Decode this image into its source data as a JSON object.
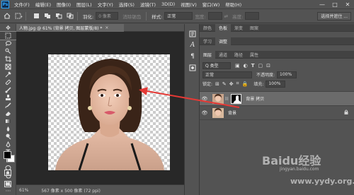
{
  "menubar": {
    "logo": "Ps",
    "items": [
      "文件(F)",
      "编辑(E)",
      "图像(I)",
      "图层(L)",
      "文字(Y)",
      "选择(S)",
      "滤镜(T)",
      "3D(D)",
      "视图(V)",
      "窗口(W)",
      "帮助(H)"
    ],
    "minimize": "—",
    "maximize": "□",
    "close": "✕"
  },
  "optbar": {
    "feather_label": "羽化:",
    "feather_value": "0 像素",
    "antialias_label": "消除锯齿",
    "style_label": "样式:",
    "style_value": "正常",
    "width_label": "宽度:",
    "height_label": "高度:",
    "select_mask_button": "选择并遮住 ..."
  },
  "document": {
    "tab_title": "人物.jpg @ 61% (背景 拷贝, 图层蒙版/8) *",
    "close": "×",
    "zoom": "61%",
    "size_info": "567 像素 x 500 像素 (72 ppi)"
  },
  "panels": {
    "top_tabs": [
      "颜色",
      "色板",
      "渐变",
      "图案"
    ],
    "top_active": 1,
    "mid_tabs": [
      "学习",
      "调整"
    ],
    "mid_active": 1,
    "layer_tabs": [
      "图层",
      "通道",
      "路径",
      "属性"
    ],
    "layer_active": 0,
    "kind_label": "Q 类型",
    "blend_mode": "正常",
    "opacity_label": "不透明度:",
    "opacity_value": "100%",
    "lock_label": "锁定:",
    "fill_label": "填充:",
    "fill_value": "100%",
    "layers": [
      {
        "name": "背景 拷贝",
        "selected": true,
        "has_mask": true,
        "locked": false
      },
      {
        "name": "背景",
        "selected": false,
        "has_mask": false,
        "locked": true
      }
    ]
  },
  "watermark": {
    "brand": "Baidu经验",
    "url": "jingyan.baidu.com",
    "site": "www.yydy.org.5"
  },
  "colors": {
    "ui_bg": "#535353",
    "canvas_bg": "#282828",
    "arrow": "#e53935"
  }
}
